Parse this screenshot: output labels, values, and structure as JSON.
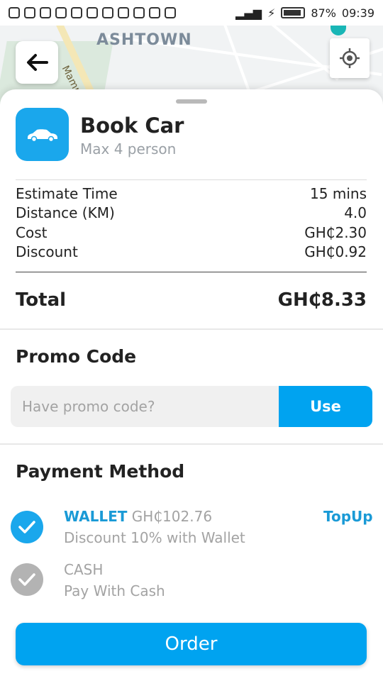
{
  "status_bar": {
    "battery": "87%",
    "time": "09:39"
  },
  "map": {
    "area_label": "ASHTOWN",
    "street_label": "Mampong"
  },
  "vehicle": {
    "title": "Book Car",
    "subtitle": "Max 4 person"
  },
  "details": [
    {
      "label": "Estimate Time",
      "value": "15 mins"
    },
    {
      "label": "Distance (KM)",
      "value": "4.0"
    },
    {
      "label": "Cost",
      "value": "GH₵2.30"
    },
    {
      "label": "Discount",
      "value": "GH₵0.92"
    }
  ],
  "total": {
    "label": "Total",
    "value": "GH₵8.33"
  },
  "promo": {
    "title": "Promo Code",
    "placeholder": "Have promo code?",
    "button": "Use"
  },
  "payment": {
    "title": "Payment Method",
    "wallet": {
      "name": "WALLET",
      "balance": "GH₵102.76",
      "desc": "Discount 10% with Wallet",
      "topup": "TopUp"
    },
    "cash": {
      "name": "CASH",
      "desc": "Pay With Cash"
    }
  },
  "order_button": "Order",
  "colors": {
    "accent": "#00a3f0",
    "check_selected": "#1aa7ec",
    "check_unselected": "#b3b3b3"
  }
}
